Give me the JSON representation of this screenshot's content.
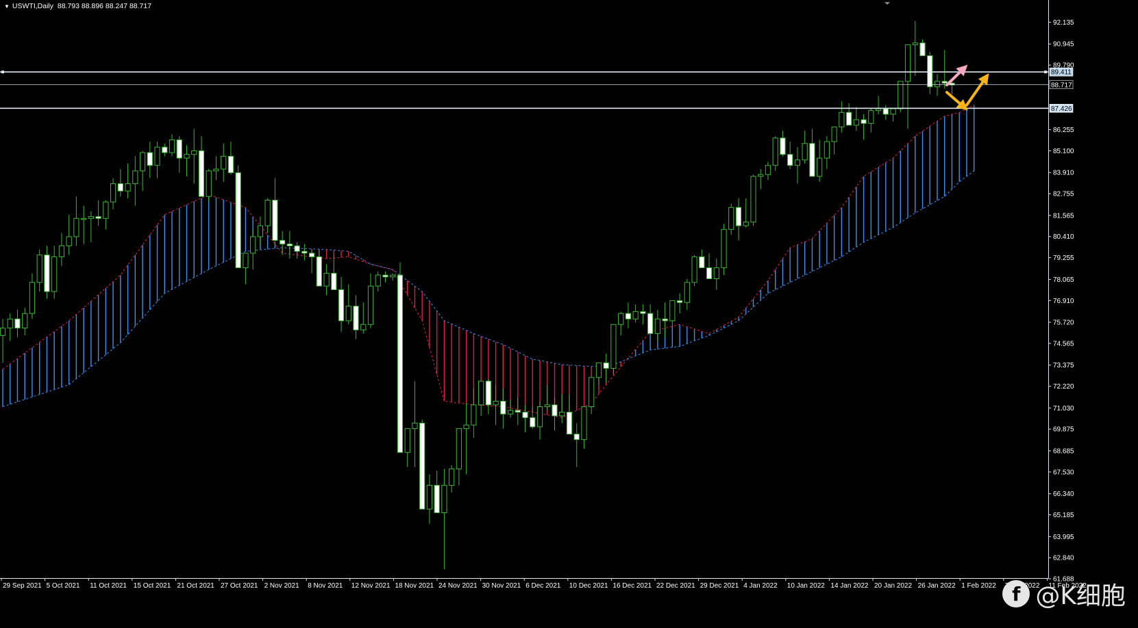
{
  "header": {
    "symbol": "USWTI,Daily",
    "ohlc": "88.793 88.896 88.247 88.717"
  },
  "watermark": {
    "badge": "f",
    "text": "@K细胞"
  },
  "colors": {
    "background": "#000000",
    "bull_body": "#000000",
    "bear_body": "#ffffff",
    "wick": "#3cb731",
    "cloud_bull": "#3d8ef0",
    "cloud_bear": "#dc1f4a",
    "span_a": "#dc1f4a",
    "span_b": "#3d8ef0",
    "hline": "#dfe8f0",
    "pink_arrow": "#f7a8c2",
    "gold_arrow": "#f5b418"
  },
  "chart_data": {
    "type": "candlestick",
    "symbol": "USWTI",
    "timeframe": "Daily",
    "ylim": [
      61.688,
      92.9
    ],
    "price_ticks": [
      "92.135",
      "90.945",
      "89.790",
      "88.600",
      "87.410",
      "86.255",
      "85.100",
      "83.910",
      "82.755",
      "81.565",
      "80.410",
      "79.255",
      "78.065",
      "76.910",
      "75.720",
      "74.565",
      "73.375",
      "72.220",
      "71.030",
      "69.875",
      "68.685",
      "67.530",
      "66.340",
      "65.185",
      "63.995",
      "62.840",
      "61.688"
    ],
    "date_labels": [
      "29 Sep 2021",
      "5 Oct 2021",
      "11 Oct 2021",
      "15 Oct 2021",
      "21 Oct 2021",
      "27 Oct 2021",
      "2 Nov 2021",
      "8 Nov 2021",
      "12 Nov 2021",
      "18 Nov 2021",
      "24 Nov 2021",
      "30 Nov 2021",
      "6 Dec 2021",
      "10 Dec 2021",
      "16 Dec 2021",
      "22 Dec 2021",
      "29 Dec 2021",
      "4 Jan 2022",
      "10 Jan 2022",
      "14 Jan 2022",
      "20 Jan 2022",
      "26 Jan 2022",
      "1 Feb 2022",
      "7 Feb 2022",
      "11 Feb 2022"
    ],
    "hlines": [
      {
        "price": 89.411,
        "label": "89.411"
      },
      {
        "price": 88.717,
        "label": "88.717"
      },
      {
        "price": 87.426,
        "label": "87.426"
      }
    ],
    "candles": [
      [
        75.0,
        75.9,
        73.5,
        75.4
      ],
      [
        75.4,
        76.2,
        74.7,
        75.9
      ],
      [
        75.9,
        76.4,
        74.9,
        75.4
      ],
      [
        75.4,
        76.5,
        75.0,
        76.2
      ],
      [
        76.2,
        78.4,
        75.9,
        77.9
      ],
      [
        77.9,
        79.7,
        77.4,
        79.4
      ],
      [
        79.4,
        79.9,
        77.0,
        77.4
      ],
      [
        77.4,
        79.9,
        77.0,
        79.3
      ],
      [
        79.3,
        80.6,
        78.8,
        79.9
      ],
      [
        79.9,
        81.6,
        79.4,
        80.4
      ],
      [
        80.4,
        82.6,
        79.9,
        81.4
      ],
      [
        81.4,
        82.1,
        80.0,
        81.4
      ],
      [
        81.4,
        81.8,
        80.1,
        81.5
      ],
      [
        81.5,
        82.4,
        81.0,
        81.4
      ],
      [
        81.4,
        82.4,
        80.8,
        82.3
      ],
      [
        82.3,
        83.6,
        81.9,
        83.3
      ],
      [
        83.3,
        84.1,
        82.6,
        82.9
      ],
      [
        82.9,
        84.4,
        82.5,
        83.3
      ],
      [
        83.3,
        84.8,
        82.1,
        84.0
      ],
      [
        84.0,
        85.1,
        82.9,
        85.0
      ],
      [
        85.0,
        85.6,
        83.6,
        84.3
      ],
      [
        84.3,
        85.6,
        83.6,
        85.3
      ],
      [
        85.3,
        85.5,
        84.8,
        85.0
      ],
      [
        85.0,
        86.0,
        84.8,
        85.7
      ],
      [
        85.7,
        85.9,
        83.9,
        84.7
      ],
      [
        84.7,
        85.4,
        83.7,
        84.9
      ],
      [
        84.9,
        86.3,
        83.3,
        85.1
      ],
      [
        85.1,
        85.9,
        83.1,
        82.6
      ],
      [
        82.6,
        84.1,
        82.3,
        84.0
      ],
      [
        84.0,
        84.8,
        83.5,
        84.1
      ],
      [
        84.1,
        85.5,
        83.4,
        84.8
      ],
      [
        84.8,
        85.6,
        83.8,
        83.9
      ],
      [
        83.9,
        84.3,
        79.3,
        78.7
      ],
      [
        78.7,
        79.3,
        77.8,
        79.5
      ],
      [
        79.5,
        80.8,
        78.6,
        80.4
      ],
      [
        80.4,
        81.5,
        79.9,
        81.0
      ],
      [
        81.0,
        82.5,
        80.6,
        82.4
      ],
      [
        82.4,
        83.6,
        79.9,
        80.2
      ],
      [
        80.2,
        80.7,
        79.4,
        80.0
      ],
      [
        80.0,
        80.7,
        79.2,
        79.9
      ],
      [
        79.9,
        80.1,
        79.2,
        79.6
      ],
      [
        79.6,
        80.0,
        79.1,
        79.5
      ],
      [
        79.5,
        79.7,
        78.4,
        79.3
      ],
      [
        79.3,
        79.7,
        77.9,
        77.7
      ],
      [
        77.7,
        78.9,
        77.2,
        78.4
      ],
      [
        78.4,
        79.3,
        77.6,
        77.5
      ],
      [
        77.5,
        78.2,
        75.2,
        75.8
      ],
      [
        75.8,
        77.8,
        75.6,
        76.6
      ],
      [
        76.6,
        77.2,
        74.8,
        75.3
      ],
      [
        75.3,
        76.8,
        75.1,
        75.6
      ],
      [
        75.6,
        78.4,
        75.4,
        77.7
      ],
      [
        77.7,
        78.5,
        77.4,
        78.3
      ],
      [
        78.3,
        78.5,
        77.9,
        78.2
      ],
      [
        78.2,
        78.4,
        78.0,
        78.3
      ],
      [
        78.3,
        79.0,
        74.7,
        68.6
      ],
      [
        68.6,
        69.1,
        67.8,
        69.9
      ],
      [
        69.9,
        72.5,
        67.8,
        70.2
      ],
      [
        70.2,
        70.4,
        66.4,
        65.5
      ],
      [
        65.5,
        67.4,
        64.7,
        66.8
      ],
      [
        66.8,
        67.6,
        65.9,
        65.3
      ],
      [
        65.3,
        67.7,
        62.2,
        66.8
      ],
      [
        66.8,
        67.9,
        66.4,
        67.7
      ],
      [
        67.7,
        68.6,
        66.8,
        69.9
      ],
      [
        69.9,
        71.3,
        67.4,
        70.1
      ],
      [
        70.1,
        72.1,
        69.4,
        71.2
      ],
      [
        71.2,
        71.9,
        70.6,
        72.5
      ],
      [
        72.5,
        72.6,
        70.7,
        71.2
      ],
      [
        71.2,
        72.3,
        70.1,
        71.4
      ],
      [
        71.4,
        72.1,
        69.9,
        70.7
      ],
      [
        70.7,
        71.5,
        70.5,
        70.9
      ],
      [
        70.9,
        71.6,
        70.1,
        70.8
      ],
      [
        70.8,
        71.2,
        69.7,
        70.5
      ],
      [
        70.5,
        71.1,
        69.9,
        70.0
      ],
      [
        70.0,
        71.4,
        69.3,
        71.1
      ],
      [
        71.1,
        72.3,
        70.9,
        71.2
      ],
      [
        71.2,
        71.6,
        69.8,
        70.6
      ],
      [
        70.6,
        71.8,
        70.2,
        70.8
      ],
      [
        70.8,
        71.8,
        70.4,
        69.6
      ],
      [
        69.6,
        70.2,
        67.8,
        69.3
      ],
      [
        69.3,
        69.9,
        68.8,
        71.1
      ],
      [
        71.1,
        72.6,
        70.7,
        72.7
      ],
      [
        72.7,
        73.4,
        72.3,
        73.5
      ],
      [
        73.5,
        74.0,
        72.4,
        73.2
      ],
      [
        73.2,
        75.3,
        72.9,
        75.6
      ],
      [
        75.6,
        76.3,
        75.0,
        76.2
      ],
      [
        76.2,
        76.8,
        75.4,
        75.9
      ],
      [
        75.9,
        76.7,
        75.7,
        76.3
      ],
      [
        76.3,
        76.7,
        75.6,
        76.2
      ],
      [
        76.2,
        76.7,
        75.5,
        75.1
      ],
      [
        75.1,
        76.4,
        74.6,
        75.9
      ],
      [
        75.9,
        76.8,
        74.9,
        75.8
      ],
      [
        75.8,
        76.9,
        75.5,
        76.9
      ],
      [
        76.9,
        77.3,
        76.2,
        76.8
      ],
      [
        76.8,
        78.1,
        76.4,
        77.9
      ],
      [
        77.9,
        79.4,
        77.7,
        79.3
      ],
      [
        79.3,
        79.7,
        78.7,
        78.7
      ],
      [
        78.7,
        79.5,
        78.1,
        78.1
      ],
      [
        78.1,
        79.2,
        77.5,
        78.7
      ],
      [
        78.7,
        81.1,
        78.3,
        80.8
      ],
      [
        80.8,
        82.2,
        80.5,
        82.0
      ],
      [
        82.0,
        82.5,
        80.2,
        81.0
      ],
      [
        81.0,
        82.5,
        80.9,
        81.2
      ],
      [
        81.2,
        83.8,
        81.0,
        83.7
      ],
      [
        83.7,
        84.1,
        83.0,
        83.8
      ],
      [
        83.8,
        84.5,
        83.5,
        84.3
      ],
      [
        84.3,
        85.9,
        84.0,
        85.8
      ],
      [
        85.8,
        86.2,
        84.8,
        84.9
      ],
      [
        84.9,
        85.6,
        84.1,
        84.3
      ],
      [
        84.3,
        85.3,
        83.3,
        84.6
      ],
      [
        84.6,
        86.2,
        84.4,
        85.5
      ],
      [
        85.5,
        86.3,
        83.8,
        83.7
      ],
      [
        83.7,
        85.7,
        83.4,
        84.7
      ],
      [
        84.7,
        85.9,
        84.1,
        85.6
      ],
      [
        85.6,
        86.4,
        84.9,
        86.4
      ],
      [
        86.4,
        87.8,
        86.1,
        87.2
      ],
      [
        87.2,
        87.7,
        86.6,
        86.5
      ],
      [
        86.5,
        87.5,
        86.2,
        86.8
      ],
      [
        86.8,
        87.1,
        85.7,
        86.6
      ],
      [
        86.6,
        87.4,
        86.1,
        87.3
      ],
      [
        87.3,
        88.1,
        87.1,
        87.4
      ],
      [
        87.4,
        87.6,
        86.8,
        87.1
      ],
      [
        87.1,
        87.4,
        86.7,
        87.4
      ],
      [
        87.4,
        88.1,
        87.2,
        88.9
      ],
      [
        88.9,
        89.5,
        86.3,
        90.9
      ],
      [
        90.9,
        92.2,
        89.2,
        91.0
      ],
      [
        91.0,
        91.2,
        90.5,
        90.3
      ],
      [
        90.3,
        90.5,
        88.2,
        88.6
      ],
      [
        88.6,
        89.3,
        88.1,
        88.9
      ],
      [
        88.9,
        90.6,
        88.5,
        88.8
      ],
      [
        88.8,
        88.9,
        88.2,
        88.7
      ]
    ],
    "span_a": [
      [
        0,
        73.15
      ],
      [
        9,
        75.8
      ],
      [
        16,
        78.3
      ],
      [
        22,
        81.6
      ],
      [
        28,
        82.7
      ],
      [
        33,
        82.0
      ],
      [
        38,
        79.5
      ],
      [
        44,
        79.2
      ],
      [
        47,
        79.3
      ],
      [
        50,
        78.9
      ],
      [
        53,
        78.6
      ],
      [
        57,
        75.8
      ],
      [
        60,
        71.4
      ],
      [
        64,
        71.2
      ],
      [
        68,
        71.1
      ],
      [
        72,
        70.8
      ],
      [
        76,
        70.5
      ],
      [
        80,
        71.3
      ],
      [
        83,
        72.8
      ],
      [
        88,
        75.2
      ],
      [
        92,
        75.6
      ],
      [
        96,
        75.1
      ],
      [
        100,
        76.0
      ],
      [
        104,
        78.0
      ],
      [
        107,
        79.8
      ],
      [
        110,
        80.3
      ],
      [
        114,
        82.0
      ],
      [
        117,
        83.7
      ],
      [
        121,
        84.7
      ],
      [
        124,
        85.9
      ],
      [
        128,
        87.0
      ],
      [
        130,
        87.2
      ],
      [
        132,
        87.6
      ]
    ],
    "span_b": [
      [
        0,
        71.1
      ],
      [
        9,
        72.3
      ],
      [
        16,
        74.6
      ],
      [
        22,
        77.3
      ],
      [
        28,
        78.6
      ],
      [
        33,
        79.6
      ],
      [
        38,
        79.8
      ],
      [
        44,
        79.7
      ],
      [
        47,
        79.6
      ],
      [
        50,
        78.9
      ],
      [
        53,
        78.6
      ],
      [
        57,
        77.4
      ],
      [
        60,
        75.8
      ],
      [
        64,
        75.1
      ],
      [
        68,
        74.5
      ],
      [
        72,
        73.7
      ],
      [
        76,
        73.4
      ],
      [
        80,
        73.3
      ],
      [
        83,
        73.4
      ],
      [
        88,
        74.2
      ],
      [
        92,
        74.4
      ],
      [
        96,
        75.0
      ],
      [
        100,
        75.8
      ],
      [
        104,
        77.3
      ],
      [
        107,
        77.9
      ],
      [
        110,
        78.5
      ],
      [
        114,
        79.3
      ],
      [
        117,
        80.1
      ],
      [
        121,
        80.9
      ],
      [
        124,
        81.7
      ],
      [
        128,
        82.6
      ],
      [
        130,
        83.4
      ],
      [
        132,
        84.0
      ]
    ],
    "arrows": [
      {
        "color_key": "pink_arrow",
        "from": [
          128.3,
          88.7
        ],
        "to": [
          130.6,
          89.6
        ]
      },
      {
        "color_key": "gold_arrow",
        "from": [
          128.3,
          88.3
        ],
        "to": [
          130.6,
          87.5
        ]
      },
      {
        "color_key": "gold_arrow",
        "from": [
          131.0,
          87.6
        ],
        "to": [
          133.6,
          89.1
        ]
      }
    ]
  }
}
